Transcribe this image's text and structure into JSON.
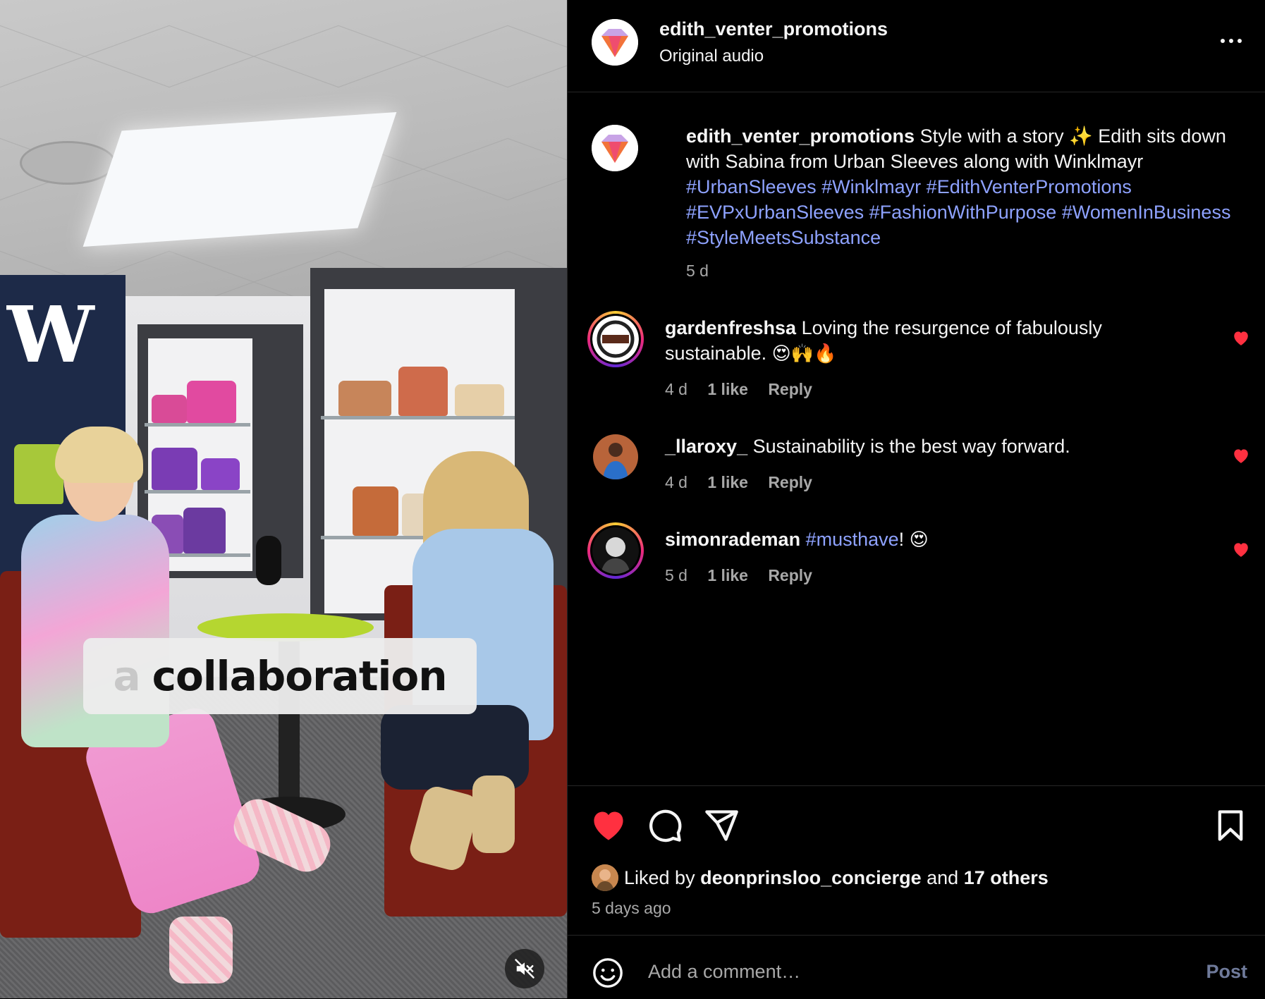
{
  "post": {
    "username": "edith_venter_promotions",
    "audio": "Original audio"
  },
  "video": {
    "caption_ghost": "a",
    "caption_text": "collaboration"
  },
  "caption": {
    "username": "edith_venter_promotions",
    "text": " Style with a story ✨  Edith sits down with Sabina from Urban Sleeves along with Winklmayr ",
    "hashtags": [
      "#UrbanSleeves",
      "#Winklmayr",
      "#EdithVenterPromotions",
      "#EVPxUrbanSleeves",
      "#FashionWithPurpose",
      "#WomenInBusiness",
      "#StyleMeetsSubstance"
    ],
    "time": "5 d"
  },
  "comments": [
    {
      "username": "gardenfreshsa",
      "text_before": " Loving the resurgence of fabulously sustainable. ",
      "emoji": "😍🙌🔥",
      "time": "4 d",
      "likes": "1 like",
      "reply": "Reply",
      "liked_color": "#ff3040"
    },
    {
      "username": "_llaroxy_",
      "text_before": " Sustainability is the best way forward.",
      "emoji": "",
      "time": "4 d",
      "likes": "1 like",
      "reply": "Reply",
      "liked_color": "#ff3040"
    },
    {
      "username": "simonrademan",
      "hashtag": "#musthave",
      "text_after": "! ",
      "emoji": "😍",
      "time": "5 d",
      "likes": "1 like",
      "reply": "Reply",
      "liked_color": "#ff3040"
    }
  ],
  "actions": {
    "like_icon": "heart-filled-icon",
    "comment_icon": "comment-bubble-icon",
    "share_icon": "paper-plane-icon",
    "save_icon": "bookmark-icon",
    "like_color": "#ff3040"
  },
  "likes": {
    "prefix": "Liked by ",
    "user": "deonprinsloo_concierge",
    "middle": " and ",
    "others": "17 others",
    "posted": "5 days ago"
  },
  "add_comment": {
    "placeholder": "Add a comment…",
    "post_label": "Post"
  }
}
